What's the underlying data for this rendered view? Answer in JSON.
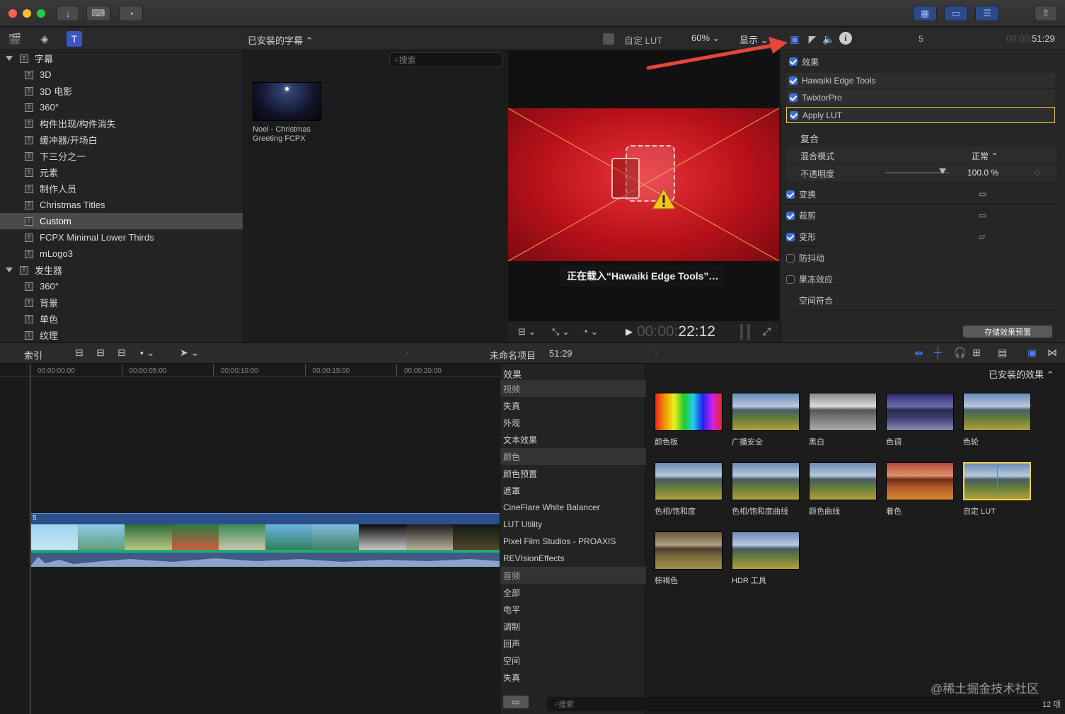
{
  "titlebar": {
    "buttons": [
      "↓",
      "⌨",
      "◔"
    ],
    "right_buttons": [
      "▦",
      "▭",
      "☰",
      "⇧"
    ]
  },
  "toolbar": {
    "browser_title": "已安装的字幕 ⌃",
    "lut_label": "自定 LUT",
    "zoom": "60%",
    "display": "显示",
    "inspector_number": "5",
    "timecode_dim": "00:00:",
    "timecode": "51:29"
  },
  "sidebar": {
    "items": [
      {
        "label": "字幕",
        "level": 0,
        "expanded": true
      },
      {
        "label": "3D",
        "level": 1
      },
      {
        "label": "3D 电影",
        "level": 1
      },
      {
        "label": "360°",
        "level": 1
      },
      {
        "label": "构件出现/构件消失",
        "level": 1
      },
      {
        "label": "缓冲器/开场白",
        "level": 1
      },
      {
        "label": "下三分之一",
        "level": 1
      },
      {
        "label": "元素",
        "level": 1
      },
      {
        "label": "制作人员",
        "level": 1
      },
      {
        "label": "Christmas Titles",
        "level": 1
      },
      {
        "label": "Custom",
        "level": 1,
        "selected": true
      },
      {
        "label": "FCPX Minimal Lower Thirds",
        "level": 1
      },
      {
        "label": "mLogo3",
        "level": 1
      },
      {
        "label": "发生器",
        "level": 0,
        "expanded": true
      },
      {
        "label": "360°",
        "level": 1
      },
      {
        "label": "背景",
        "level": 1
      },
      {
        "label": "单色",
        "level": 1
      },
      {
        "label": "纹理",
        "level": 1
      }
    ]
  },
  "browser": {
    "search_placeholder": "搜索",
    "clip_title_line1": "Noel - Christmas",
    "clip_title_line2": "Greeting FCPX"
  },
  "viewer": {
    "loading_text": "正在载入“Hawaiki Edge Tools”…",
    "timecode_dim": "00:00:",
    "timecode": "22:12"
  },
  "inspector": {
    "effects_label": "效果",
    "effects": [
      {
        "label": "Hawaiki Edge Tools",
        "checked": true
      },
      {
        "label": "TwixtorPro",
        "checked": true
      },
      {
        "label": "Apply LUT",
        "checked": true,
        "highlighted": true
      }
    ],
    "composite_label": "复合",
    "blend_mode_label": "混合模式",
    "blend_mode_value": "正常 ⌃",
    "opacity_label": "不透明度",
    "opacity_value": "100.0 %",
    "sections": [
      {
        "label": "变换",
        "checked": true
      },
      {
        "label": "裁剪",
        "checked": true
      },
      {
        "label": "变形",
        "checked": true
      },
      {
        "label": "防抖动",
        "checked": false
      },
      {
        "label": "果冻效应",
        "checked": false
      },
      {
        "label": "空间符合",
        "checked": null
      }
    ],
    "save_preset": "存储效果预置"
  },
  "timeline_bar": {
    "index": "索引",
    "project_name": "未命名项目",
    "project_duration": "51:29"
  },
  "timeline": {
    "ruler": [
      "00:00:00:00",
      "00:00:05:00",
      "00:00:10:00",
      "00:00:15:00",
      "00:00:20:00"
    ],
    "clip_number": "5"
  },
  "effects_browser": {
    "header": "效果",
    "installed": "已安装的效果 ⌃",
    "categories": [
      {
        "label": "视频",
        "header": true
      },
      {
        "label": "失真"
      },
      {
        "label": "外观"
      },
      {
        "label": "文本效果"
      },
      {
        "label": "颜色",
        "header": true
      },
      {
        "label": "颜色预置"
      },
      {
        "label": "遮罩"
      },
      {
        "label": "CineFlare White Balancer"
      },
      {
        "label": "LUT Utility"
      },
      {
        "label": "Pixel Film Studios - PROAXIS"
      },
      {
        "label": "REVIsionEffects"
      },
      {
        "label": "音频",
        "header": true
      },
      {
        "label": "全部"
      },
      {
        "label": "电平"
      },
      {
        "label": "调制"
      },
      {
        "label": "回声"
      },
      {
        "label": "空间"
      },
      {
        "label": "失真"
      }
    ],
    "thumbnails": [
      {
        "label": "颜色板"
      },
      {
        "label": "广播安全"
      },
      {
        "label": "黑白"
      },
      {
        "label": "色调"
      },
      {
        "label": "色轮"
      },
      {
        "label": "色相/饱和度"
      },
      {
        "label": "色相/饱和度曲线"
      },
      {
        "label": "颜色曲线"
      },
      {
        "label": "着色"
      },
      {
        "label": "自定 LUT",
        "selected": true
      },
      {
        "label": "棕褐色"
      },
      {
        "label": "HDR 工具"
      }
    ],
    "search_placeholder": "搜索",
    "count": "12 项"
  },
  "watermark": "@稀土掘金技术社区",
  "colors": {
    "accent": "#3b6fd9",
    "selection": "#f0d34a",
    "arrow": "#e8453c",
    "viewer_red": "#c0141c"
  }
}
